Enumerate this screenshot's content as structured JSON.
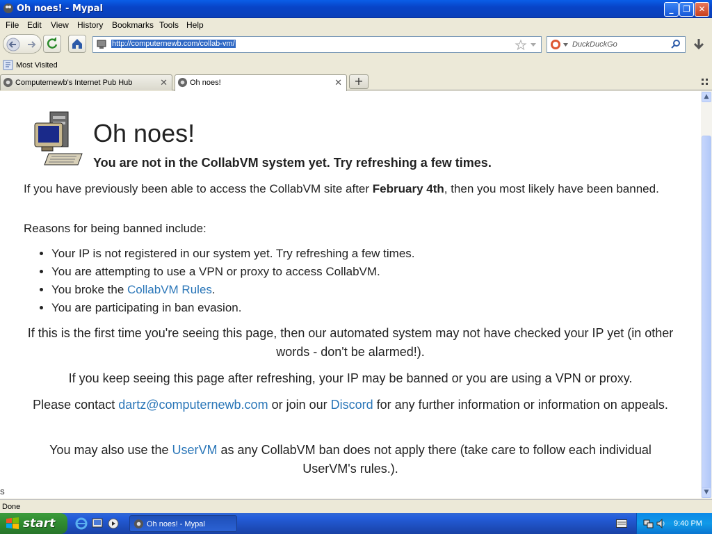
{
  "window": {
    "title": "Oh noes! - Mypal",
    "minimize": "_",
    "restore": "❐",
    "close": "✕"
  },
  "menu": [
    "File",
    "Edit",
    "View",
    "History",
    "Bookmarks",
    "Tools",
    "Help"
  ],
  "toolbar": {
    "url": "http://computernewb.com/collab-vm/",
    "search_placeholder": "DuckDuckGo"
  },
  "bookmarks": {
    "most_visited": "Most Visited"
  },
  "tabs": [
    {
      "label": "Computernewb's Internet Pub Hub",
      "close": "✕"
    },
    {
      "label": "Oh noes!",
      "close": "✕"
    }
  ],
  "new_tab": "+",
  "page": {
    "heading": "Oh noes!",
    "subheading": "You are not in the CollabVM system yet. Try refreshing a few times.",
    "p1_before": "If you have previously been able to access the CollabVM site after ",
    "p1_bold": "February 4th",
    "p1_after": ", then you most likely have been banned.",
    "p2": "Reasons for being banned include:",
    "reasons": {
      "r1": "Your IP is not registered in our system yet. Try refreshing a few times.",
      "r2": "You are attempting to use a VPN or proxy to access CollabVM.",
      "r3_before": "You broke the ",
      "r3_link": "CollabVM Rules",
      "r3_after": ".",
      "r4": "You are participating in ban evasion."
    },
    "c1": "If this is the first time you're seeing this page, then our automated system may not have checked your IP yet (in other words - don't be alarmed!).",
    "c2": "If you keep seeing this page after refreshing, your IP may be banned or you are using a VPN or proxy.",
    "c3_before": "Please contact ",
    "c3_email": "dartz@computernewb.com",
    "c3_mid": " or join our ",
    "c3_discord": "Discord",
    "c3_after": " for any further information or information on appeals.",
    "c4_before": "You may also use the ",
    "c4_link": "UserVM",
    "c4_after": " as any CollabVM ban does not apply there (take care to follow each individual UserVM's rules.)."
  },
  "stray_char": "S",
  "status": "Done",
  "taskbar": {
    "start": "start",
    "task": "Oh noes! - Mypal",
    "clock": "9:40 PM"
  }
}
